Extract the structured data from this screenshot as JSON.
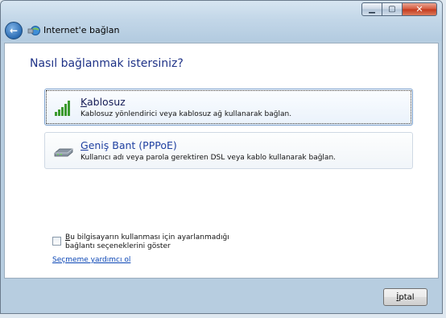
{
  "window": {
    "title": "Internet'e bağlan",
    "controls": [
      "minimize-icon",
      "maximize-icon",
      "close-icon"
    ]
  },
  "main": {
    "heading": "Nasıl bağlanmak istersiniz?",
    "options": [
      {
        "title_accel": "K",
        "title_rest": "ablosuz",
        "description": "Kablosuz yönlendirici veya kablosuz ağ kullanarak bağlan.",
        "icon": "wireless-signal-icon",
        "selected": true
      },
      {
        "title_accel": "G",
        "title_rest": "eniş Bant (PPPoE)",
        "description": "Kullanıcı adı veya parola gerektiren DSL veya kablo kullanarak bağlan.",
        "icon": "broadband-modem-icon",
        "selected": false
      }
    ],
    "checkbox": {
      "label_accel": "B",
      "label_rest": "u bilgisayarın kullanması için ayarlanmadığı bağlantı seçeneklerini göster",
      "checked": false
    },
    "help_link": "Seçmeme yardımcı ol"
  },
  "footer": {
    "cancel_accel": "İ",
    "cancel_rest": "ptal"
  },
  "colors": {
    "heading": "#1e3287",
    "link": "#0b46b5",
    "close": "#c3381c"
  }
}
